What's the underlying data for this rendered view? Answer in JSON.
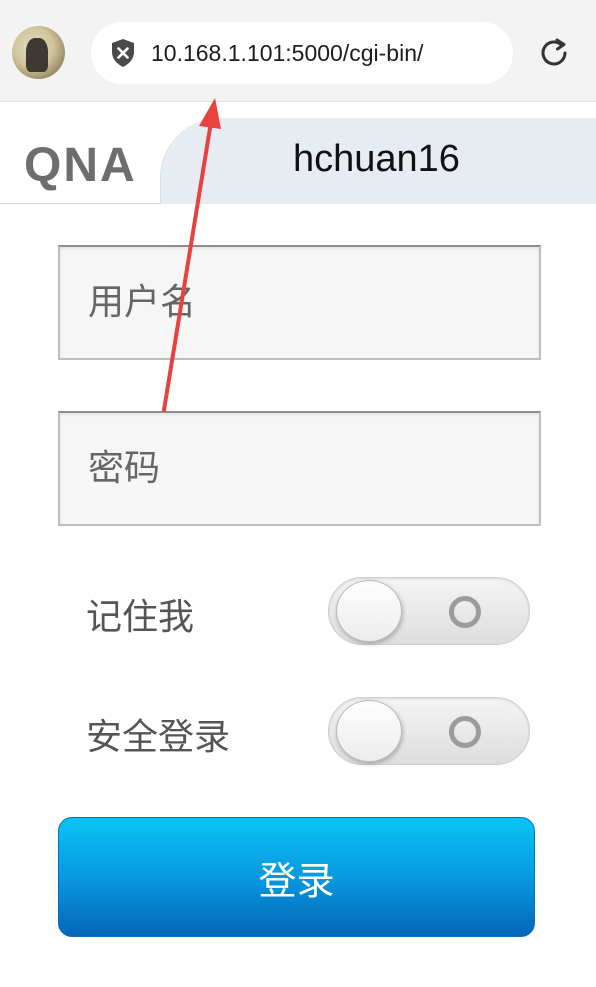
{
  "browser": {
    "url": "10.168.1.101:5000/cgi-bin/",
    "security_icon": "shield-x-icon",
    "reload_icon": "reload-icon"
  },
  "header": {
    "logo_text": "QNA",
    "server_name": "hchuan16"
  },
  "form": {
    "username_placeholder": "用户名",
    "password_placeholder": "密码",
    "remember_label": "记住我",
    "remember_on": false,
    "secure_login_label": "安全登录",
    "secure_login_on": false,
    "login_button": "登录"
  },
  "colors": {
    "button_top": "#0bc4f5",
    "button_bottom": "#0566b8",
    "annotation_arrow": "#e8423f"
  }
}
